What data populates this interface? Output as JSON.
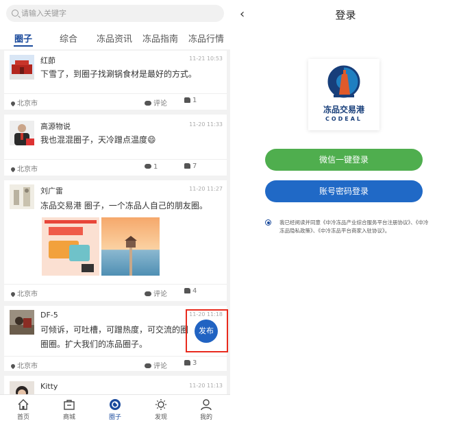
{
  "search": {
    "placeholder": "请输入关键字"
  },
  "tabs": [
    {
      "label": "圈子"
    },
    {
      "label": "综合"
    },
    {
      "label": "冻品资讯"
    },
    {
      "label": "冻品指南"
    },
    {
      "label": "冻品行情"
    }
  ],
  "posts": [
    {
      "name": "红莭",
      "time": "11-21 10:53",
      "text": "下雪了，到圈子找涮锅食材是最好的方式。",
      "location": "北京市",
      "comment": "评论",
      "likes": "1"
    },
    {
      "name": "高源物说",
      "time": "11-20 11:33",
      "text": "我也混混圈子，天冷蹭点温度😄",
      "location": "北京市",
      "comment": "1",
      "likes": "7"
    },
    {
      "name": "刘广雷",
      "time": "11-20 11:27",
      "text": "冻品交易港 圈子，一个冻品人自己的朋友圈。",
      "location": "北京市",
      "comment": "评论",
      "likes": "4"
    },
    {
      "name": "DF-5",
      "time": "11-20 11:18",
      "text_line1": "可倾诉，可吐槽，可蹭热度，可交流的圈",
      "text_line2": "圈圈。扩大我们的冻品圈子。",
      "location": "北京市",
      "comment": "评论",
      "likes": "3"
    },
    {
      "name": "Kitty",
      "time": "11-20 11:13"
    }
  ],
  "publish_label": "发布",
  "bottom_nav": [
    {
      "label": "首页",
      "icon": "home-icon"
    },
    {
      "label": "商城",
      "icon": "shop-icon"
    },
    {
      "label": "圈子",
      "icon": "circle-icon"
    },
    {
      "label": "发现",
      "icon": "discover-icon"
    },
    {
      "label": "我的",
      "icon": "profile-icon"
    }
  ],
  "login": {
    "back_icon": "‹",
    "title": "登录",
    "logo_cn": "冻品交易港",
    "logo_en": "CODEAL",
    "wechat_button": "微信一键登录",
    "account_button": "账号密码登录",
    "agreement": "我已经阅读并同意《中冷冻品产业综合服务平台注册协议》、《中冷冻品隐私政策》、《中冷冻品平台商家入驻协议》。"
  },
  "colors": {
    "brand_blue": "#1a4a9c",
    "wechat_green": "#4fae4e",
    "account_blue": "#2069c6",
    "highlight_red": "#e8291c"
  }
}
